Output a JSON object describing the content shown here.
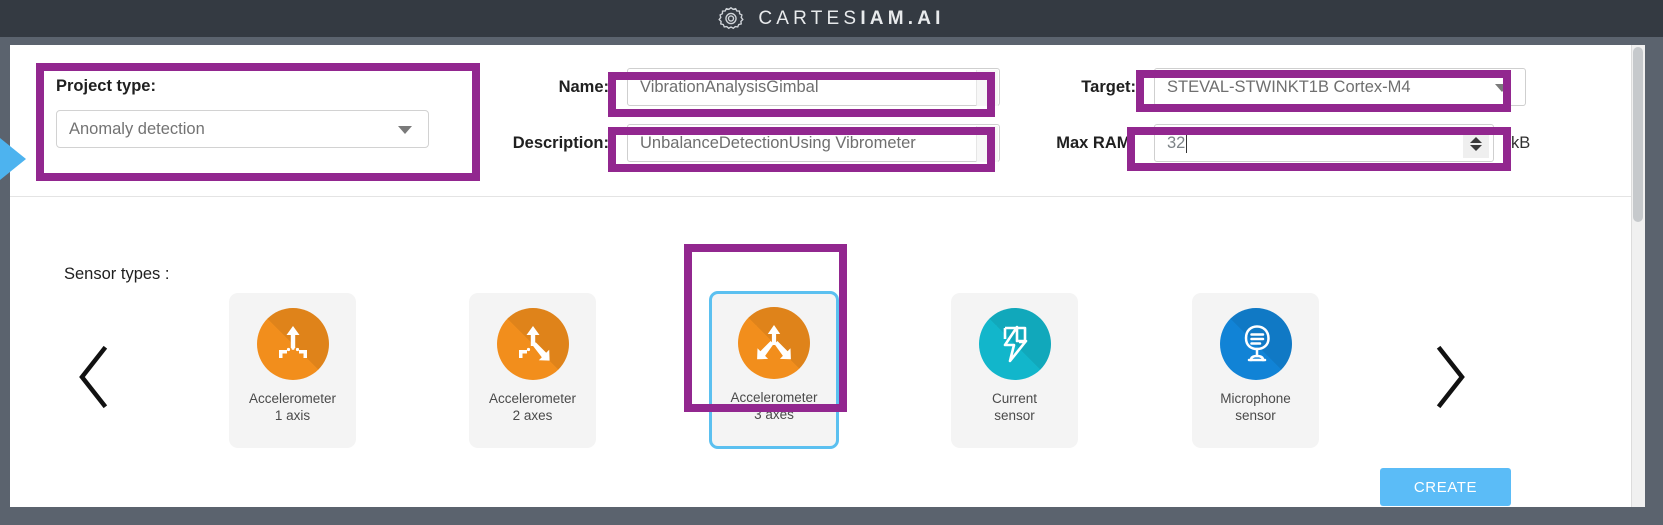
{
  "header": {
    "brand_prefix": "CARTES",
    "brand_suffix": "IAM.AI",
    "logo_icon": "gear-icon"
  },
  "form": {
    "project_type": {
      "label": "Project type:",
      "value": "Anomaly detection",
      "caret_icon": "chevron-down-icon"
    },
    "name": {
      "label": "Name:",
      "value": "VibrationAnalysisGimbal"
    },
    "description": {
      "label": "Description:",
      "value": "UnbalanceDetectionUsing Vibrometer"
    },
    "target": {
      "label": "Target:",
      "value": "STEVAL-STWINKT1B Cortex-M4",
      "caret_icon": "chevron-down-icon"
    },
    "max_ram": {
      "label": "Max RAM:",
      "value": "32",
      "unit": "kB",
      "spinner_icon": "spinner-updown-icon"
    }
  },
  "sensors": {
    "label": "Sensor types :",
    "prev_icon": "chevron-left-icon",
    "next_icon": "chevron-right-icon",
    "selected_index": 2,
    "cards": [
      {
        "caption": "Accelerometer\n1 axis",
        "icon": "accelerometer-1-axis-icon",
        "color": "#F28E1C"
      },
      {
        "caption": "Accelerometer\n2 axes",
        "icon": "accelerometer-2-axes-icon",
        "color": "#F28E1C"
      },
      {
        "caption": "Accelerometer\n3 axes",
        "icon": "accelerometer-3-axes-icon",
        "color": "#F28E1C"
      },
      {
        "caption": "Current\nsensor",
        "icon": "current-sensor-icon",
        "color": "#12B6CB"
      },
      {
        "caption": "Microphone\nsensor",
        "icon": "microphone-sensor-icon",
        "color": "#1183D6"
      }
    ]
  },
  "actions": {
    "create_label": "CREATE"
  },
  "colors": {
    "titlebar": "#343a42",
    "chrome": "#5b636e",
    "accent_blue": "#5bbcf7",
    "selected_border": "#5bc0f0",
    "annotation_purple": "#92278f",
    "orange": "#F28E1C",
    "teal": "#12B6CB",
    "blue": "#1183D6"
  }
}
